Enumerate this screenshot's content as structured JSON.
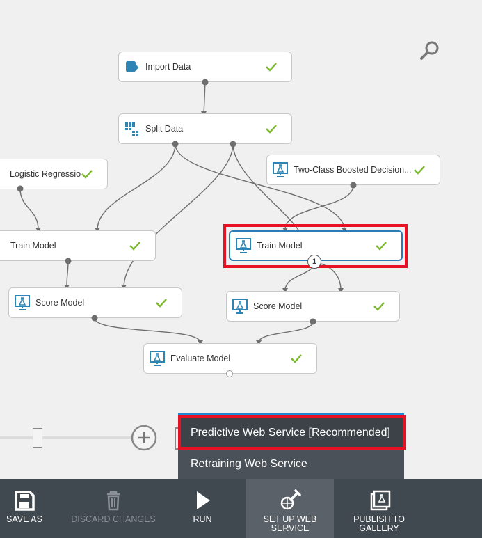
{
  "canvas": {
    "nodes": [
      {
        "label": "Import Data",
        "icon": "database-icon",
        "status": "complete"
      },
      {
        "label": "Split Data",
        "icon": "split-table-icon",
        "status": "complete"
      },
      {
        "label": "Logistic Regression",
        "icon": "",
        "status": "complete"
      },
      {
        "label": "Two-Class Boosted Decision...",
        "icon": "flask-monitor-icon",
        "status": "complete"
      },
      {
        "label": "Train Model",
        "icon": "flask-monitor-icon",
        "status": "complete"
      },
      {
        "label": "Train Model",
        "icon": "flask-monitor-icon",
        "status": "complete",
        "selected": true
      },
      {
        "label": "Score Model",
        "icon": "flask-monitor-icon",
        "status": "complete"
      },
      {
        "label": "Score Model",
        "icon": "flask-monitor-icon",
        "status": "complete"
      },
      {
        "label": "Evaluate Model",
        "icon": "flask-monitor-icon",
        "status": "complete"
      }
    ],
    "badge": "1",
    "colors": {
      "check": "#7cb82f",
      "icon": "#2e84b4",
      "highlight": "#e81123",
      "selected_border": "#2b7bb9"
    }
  },
  "web_service_menu": {
    "items": [
      {
        "label": "Predictive Web Service [Recommended]",
        "highlighted": true
      },
      {
        "label": "Retraining Web Service"
      }
    ]
  },
  "toolbar": {
    "buttons": [
      {
        "label": "SAVE AS",
        "icon": "save-icon",
        "enabled": true
      },
      {
        "label": "DISCARD CHANGES",
        "icon": "trash-icon",
        "enabled": false
      },
      {
        "label": "RUN",
        "icon": "play-icon",
        "enabled": true
      },
      {
        "label": "SET UP WEB SERVICE",
        "icon": "web-service-setup-icon",
        "enabled": true,
        "active": true
      },
      {
        "label": "PUBLISH TO GALLERY",
        "icon": "publish-gallery-icon",
        "enabled": true
      }
    ]
  }
}
